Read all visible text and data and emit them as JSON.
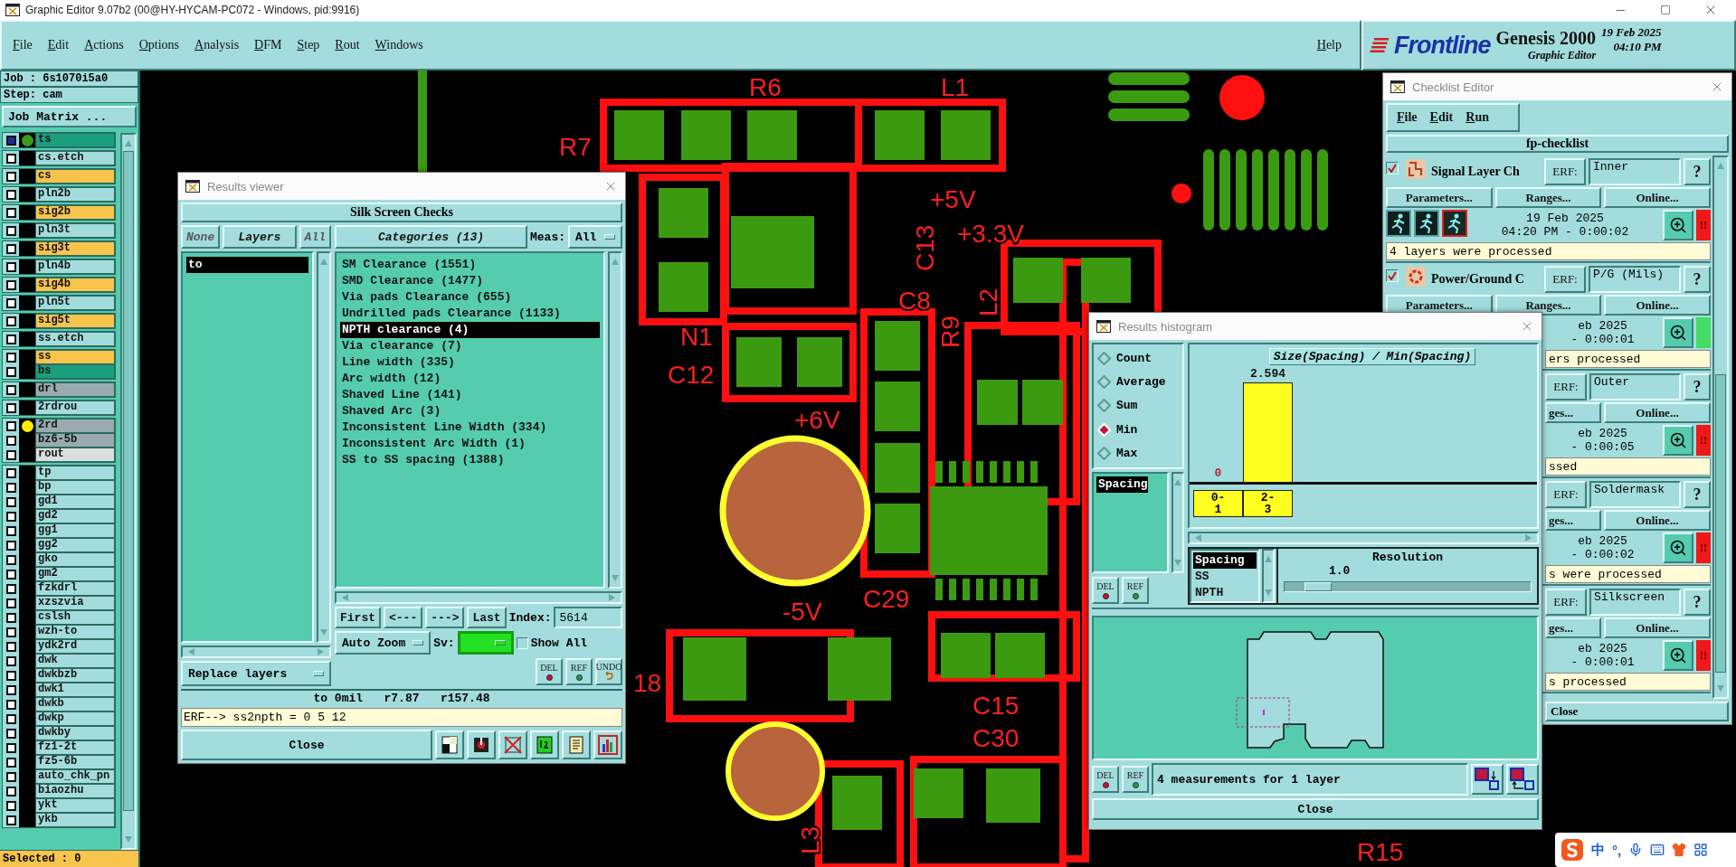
{
  "window": {
    "title": "Graphic Editor 9.07b2 (00@HY-HYCAM-PC072 - Windows, pid:9916)"
  },
  "menu": [
    "File",
    "Edit",
    "Actions",
    "Options",
    "Analysis",
    "DFM",
    "Step",
    "Rout",
    "Windows"
  ],
  "help": "Help",
  "brand": {
    "logo": "Frontline",
    "product": "Genesis 2000",
    "subtitle": "Graphic Editor",
    "date": "19 Feb 2025",
    "time": "04:10 PM"
  },
  "job_panel": {
    "job": "Job : 6s1070i5a0",
    "step": "Step: cam",
    "matrix_button": "Job Matrix ...",
    "selected": "Selected : 0"
  },
  "layer_groups": [
    [
      {
        "name": "ts",
        "color": "#1b9e7c",
        "active": true,
        "dot": {
          "color": "#3d9a1c"
        }
      }
    ],
    [
      {
        "name": "cs.etch",
        "color": "#a3dcdc",
        "active": false
      }
    ],
    [
      {
        "name": "cs",
        "color": "#f8c44c",
        "active": false
      }
    ],
    [
      {
        "name": "pln2b",
        "color": "#a3dcdc",
        "active": false
      }
    ],
    [
      {
        "name": "sig2b",
        "color": "#f8c44c",
        "active": false
      }
    ],
    [
      {
        "name": "pln3t",
        "color": "#a3dcdc",
        "active": false
      }
    ],
    [
      {
        "name": "sig3t",
        "color": "#f8c44c",
        "active": false
      }
    ],
    [
      {
        "name": "pln4b",
        "color": "#a3dcdc",
        "active": false
      }
    ],
    [
      {
        "name": "sig4b",
        "color": "#f8c44c",
        "active": false
      }
    ],
    [
      {
        "name": "pln5t",
        "color": "#a3dcdc",
        "active": false
      }
    ],
    [
      {
        "name": "sig5t",
        "color": "#f8c44c",
        "active": false
      }
    ],
    [
      {
        "name": "ss.etch",
        "color": "#a3dcdc",
        "active": false
      }
    ],
    [
      {
        "name": "ss",
        "color": "#f8c44c",
        "active": false
      },
      {
        "name": "bs",
        "color": "#1b9e7c",
        "active": false
      }
    ],
    [
      {
        "name": "drl",
        "color": "#9aabae",
        "active": false
      }
    ],
    [
      {
        "name": "2rdrou",
        "color": "#a3dcdc",
        "active": false
      }
    ],
    [
      {
        "name": "2rd",
        "color": "#9aabae",
        "active": false,
        "dot": {
          "color": "#ffee00"
        }
      },
      {
        "name": "bz6-5b",
        "color": "#9aabae",
        "active": false
      },
      {
        "name": "rout",
        "color": "#dadede",
        "active": false
      }
    ],
    [
      {
        "name": "tp",
        "color": "#a3dcdc",
        "active": false
      },
      {
        "name": "bp",
        "color": "#a3dcdc",
        "active": false
      },
      {
        "name": "gd1",
        "color": "#a3dcdc",
        "active": false
      },
      {
        "name": "gd2",
        "color": "#a3dcdc",
        "active": false
      },
      {
        "name": "gg1",
        "color": "#a3dcdc",
        "active": false
      },
      {
        "name": "gg2",
        "color": "#a3dcdc",
        "active": false
      },
      {
        "name": "gko",
        "color": "#a3dcdc",
        "active": false
      },
      {
        "name": "gm2",
        "color": "#a3dcdc",
        "active": false
      },
      {
        "name": "fzkdrl",
        "color": "#a3dcdc",
        "active": false
      },
      {
        "name": "xzszvia",
        "color": "#a3dcdc",
        "active": false
      },
      {
        "name": "cslsh",
        "color": "#a3dcdc",
        "active": false
      },
      {
        "name": "wzh-to",
        "color": "#a3dcdc",
        "active": false
      },
      {
        "name": "ydk2rd",
        "color": "#a3dcdc",
        "active": false
      },
      {
        "name": "dwk",
        "color": "#a3dcdc",
        "active": false
      },
      {
        "name": "dwkbzb",
        "color": "#a3dcdc",
        "active": false
      },
      {
        "name": "dwk1",
        "color": "#a3dcdc",
        "active": false
      },
      {
        "name": "dwkb",
        "color": "#a3dcdc",
        "active": false
      },
      {
        "name": "dwkp",
        "color": "#a3dcdc",
        "active": false
      },
      {
        "name": "dwkby",
        "color": "#a3dcdc",
        "active": false
      },
      {
        "name": "fz1-2t",
        "color": "#a3dcdc",
        "active": false
      },
      {
        "name": "fz5-6b",
        "color": "#a3dcdc",
        "active": false
      },
      {
        "name": "auto_chk_pn",
        "color": "#a3dcdc",
        "active": false
      },
      {
        "name": "biaozhu",
        "color": "#a3dcdc",
        "active": false
      },
      {
        "name": "ykt",
        "color": "#a3dcdc",
        "active": false
      },
      {
        "name": "ykb",
        "color": "#a3dcdc",
        "active": false
      }
    ]
  ],
  "canvas": {
    "labels": [
      "R6",
      "L1",
      "R7",
      "+5V",
      "+3.3V",
      "C13",
      "C8",
      "N1",
      "C12",
      "R9",
      "L2",
      "+6V",
      "C29",
      "-5V",
      "C15",
      "C30",
      "18",
      "L3",
      "R15"
    ]
  },
  "results_viewer": {
    "title": "Results viewer",
    "heading": "Silk Screen Checks",
    "layer_buttons": [
      "None",
      "Layers",
      "All"
    ],
    "layers": [
      {
        "name": "to",
        "selected": true
      }
    ],
    "categories_title": "Categories (13)",
    "meas_label": "Meas:",
    "meas_value": "All",
    "categories": [
      {
        "label": "SM Clearance (1551)",
        "selected": false
      },
      {
        "label": "SMD Clearance (1477)",
        "selected": false
      },
      {
        "label": "Via pads Clearance (655)",
        "selected": false
      },
      {
        "label": "Undrilled pads Clearance (1133)",
        "selected": false
      },
      {
        "label": "NPTH clearance (4)",
        "selected": true
      },
      {
        "label": "Via clearance (7)",
        "selected": false
      },
      {
        "label": "Line width (335)",
        "selected": false
      },
      {
        "label": "Arc width (12)",
        "selected": false
      },
      {
        "label": "Shaved Line (141)",
        "selected": false
      },
      {
        "label": "Shaved Arc (3)",
        "selected": false
      },
      {
        "label": "Inconsistent Line Width (334)",
        "selected": false
      },
      {
        "label": "Inconsistent Arc Width (1)",
        "selected": false
      },
      {
        "label": "SS to SS spacing (1388)",
        "selected": false
      }
    ],
    "nav": [
      "First",
      "<---",
      "--->",
      "Last"
    ],
    "index_label": "Index:",
    "index_value": "5614",
    "zoom_mode": "Auto Zoom",
    "sv_label": "Sv:",
    "sv": {
      "color": "#22e022"
    },
    "show_all": {
      "label": "Show All",
      "checked": false
    },
    "layer_mode": "Replace layers",
    "mark_buttons": [
      "DEL",
      "REF",
      "UNDO"
    ],
    "status": "to 0mil   r7.87   r157.48",
    "erf_line": "ERF--> ss2npth = 0 5 12",
    "close": "Close"
  },
  "checklist": {
    "title": "Checklist Editor",
    "menu": [
      "File",
      "Edit",
      "Run"
    ],
    "name": "fp-checklist",
    "items": [
      {
        "kind": "full",
        "checked": true,
        "name": "Signal Layer Ch",
        "erf_label": "ERF:",
        "erf_value": "Inner",
        "help": "?",
        "buttons": [
          "Parameters...",
          "Ranges...",
          "Online..."
        ],
        "date": "19 Feb 2025",
        "time": "04:20 PM - 0:00:02",
        "passed": false,
        "status_mark": "!!",
        "message": "4 layers were processed"
      },
      {
        "kind": "lower_hidden",
        "checked": true,
        "name": "Power/Ground C",
        "erf_label": "ERF:",
        "erf_value": "P/G (Mils)",
        "help": "?",
        "buttons": [
          "Parameters...",
          "Ranges...",
          "Online..."
        ],
        "date": "eb 2025",
        "time": "- 0:00:01",
        "passed": true,
        "message": "ers processed"
      },
      {
        "kind": "left_hidden",
        "erf_label": "ERF:",
        "erf_value": "Outer",
        "help": "?",
        "buttons": [
          "ges...",
          "Online..."
        ],
        "date": "eb 2025",
        "time": "- 0:00:05",
        "passed": false,
        "status_mark": "!!",
        "message": "ssed"
      },
      {
        "kind": "left_hidden",
        "erf_label": "ERF:",
        "erf_value": "Soldermask",
        "help": "?",
        "buttons": [
          "ges...",
          "Online..."
        ],
        "date": "eb 2025",
        "time": "- 0:00:02",
        "passed": false,
        "status_mark": "!!",
        "message": "s were processed"
      },
      {
        "kind": "left_hidden",
        "erf_label": "ERF:",
        "erf_value": "Silkscreen",
        "help": "?",
        "buttons": [
          "ges...",
          "Online..."
        ],
        "date": "eb 2025",
        "time": "- 0:00:01",
        "passed": false,
        "status_mark": "!!",
        "message": "s processed"
      }
    ],
    "close": "Close"
  },
  "histogram": {
    "title": "Results histogram",
    "modes": [
      {
        "label": "Count",
        "selected": false
      },
      {
        "label": "Average",
        "selected": false
      },
      {
        "label": "Sum",
        "selected": false
      },
      {
        "label": "Min",
        "selected": true
      },
      {
        "label": "Max",
        "selected": false
      }
    ],
    "fields": [
      {
        "name": "Spacing",
        "selected": true
      }
    ],
    "field_buttons": [
      "DEL",
      "REF"
    ],
    "chart_title": "Size(Spacing) / Min(Spacing)",
    "bins": [
      {
        "kind": "empty",
        "label": "0-1",
        "value": "0"
      },
      {
        "kind": "bar",
        "label": "2-3",
        "value": "2.594"
      }
    ],
    "measures": [
      {
        "name": "Spacing",
        "selected": true
      },
      {
        "name": "SS",
        "selected": false
      },
      {
        "name": "NPTH",
        "selected": false
      }
    ],
    "resolution": {
      "label": "Resolution",
      "value": "1.0",
      "level": 0.09
    },
    "bottom_buttons": [
      "DEL",
      "REF"
    ],
    "message": "4 measurements for 1 layer",
    "close": "Close"
  },
  "ime": {
    "mode": "中",
    "punctuation": "°,"
  }
}
